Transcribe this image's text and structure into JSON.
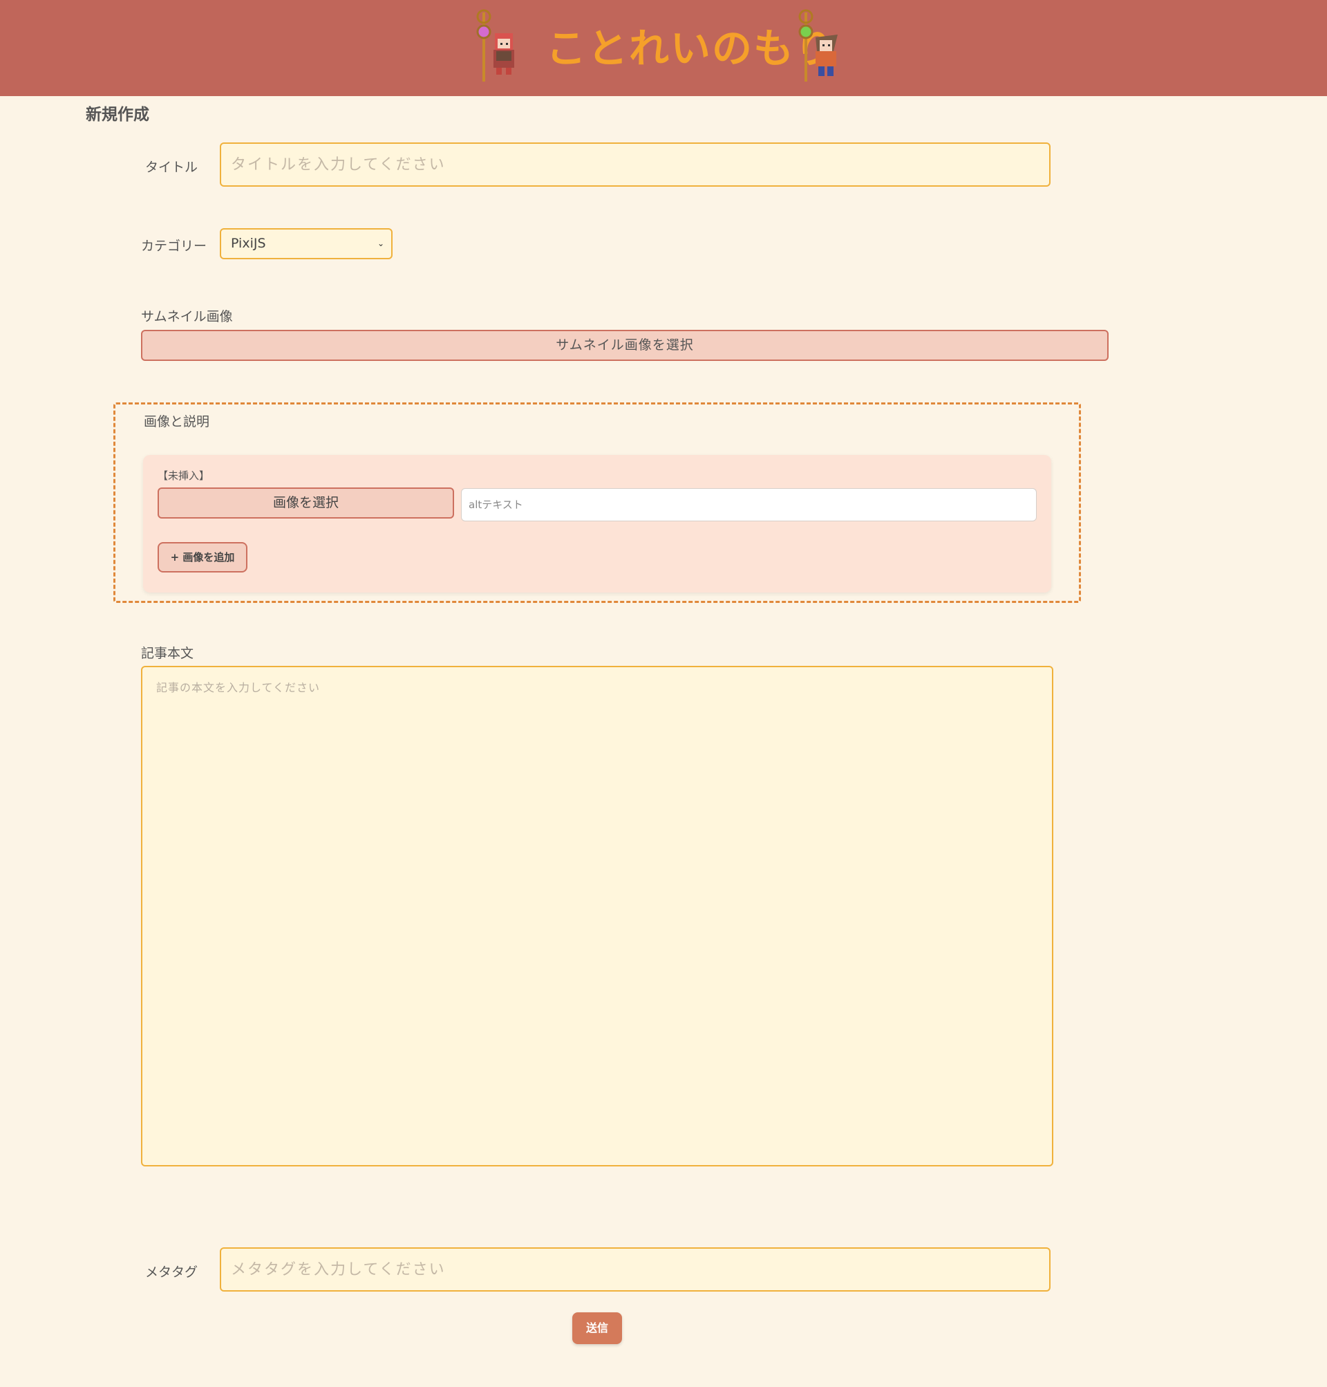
{
  "header": {
    "logo_text": "ことれいのもり"
  },
  "page": {
    "title": "新規作成"
  },
  "form": {
    "title_label": "タイトル",
    "title_placeholder": "タイトルを入力してください",
    "category_label": "カテゴリー",
    "category_selected": "PixiJS",
    "thumbnail_label": "サムネイル画像",
    "thumbnail_button": "サムネイル画像を選択",
    "images_section_label": "画像と説明",
    "image_item_status": "【未挿入】",
    "image_select_button": "画像を選択",
    "alt_placeholder": "altテキスト",
    "add_image_button": "+ 画像を追加",
    "body_label": "記事本文",
    "body_placeholder": "記事の本文を入力してください",
    "meta_label": "メタタグ",
    "meta_placeholder": "メタタグを入力してください",
    "submit_button": "送信"
  },
  "colors": {
    "header_bg": "#c0665a",
    "page_bg": "#fcf4e6",
    "accent_orange": "#f0b13c",
    "button_pink": "#f4cfc1",
    "submit_bg": "#d47a5a"
  }
}
